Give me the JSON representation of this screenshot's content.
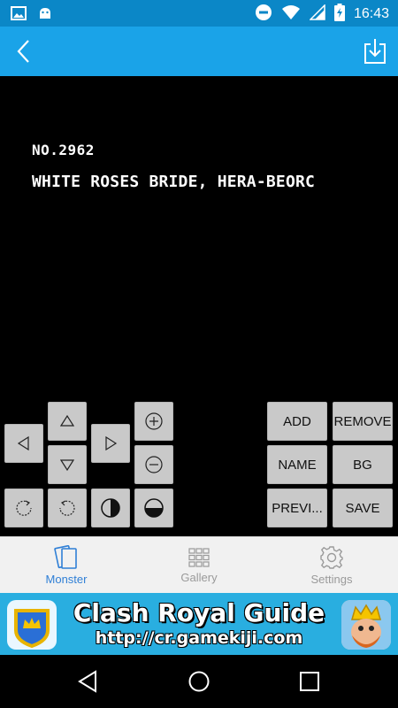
{
  "status_bar": {
    "time": "16:43",
    "left_icons": [
      "image-icon",
      "android-icon"
    ],
    "right_icons": [
      "do-not-disturb-icon",
      "wifi-icon",
      "signal-icon",
      "battery-charging-icon"
    ]
  },
  "app_bar": {
    "back_icon": "back-arrow-icon",
    "download_icon": "download-icon"
  },
  "monster": {
    "number": "NO.2962",
    "name": "WHITE ROSES BRIDE, HERA-BEORC"
  },
  "controls": {
    "add_label": "ADD",
    "remove_label": "REMOVE",
    "name_label": "NAME",
    "bg_label": "BG",
    "preview_label": "PREVI...",
    "save_label": "SAVE"
  },
  "bottom_nav": {
    "items": [
      {
        "label": "Monster",
        "icon": "cards-icon",
        "active": true
      },
      {
        "label": "Gallery",
        "icon": "grid-icon",
        "active": false
      },
      {
        "label": "Settings",
        "icon": "gear-icon",
        "active": false
      }
    ]
  },
  "ad": {
    "title": "Clash Royal Guide",
    "url": "http://cr.gamekiji.com"
  },
  "colors": {
    "status_bar": "#0b87c7",
    "app_bar": "#1aa3e8",
    "canvas": "#000000",
    "button": "#c9c9c9",
    "nav_active": "#2f7fd6",
    "nav_inactive": "#9a9a9a",
    "ad_bg": "#29aee0"
  }
}
